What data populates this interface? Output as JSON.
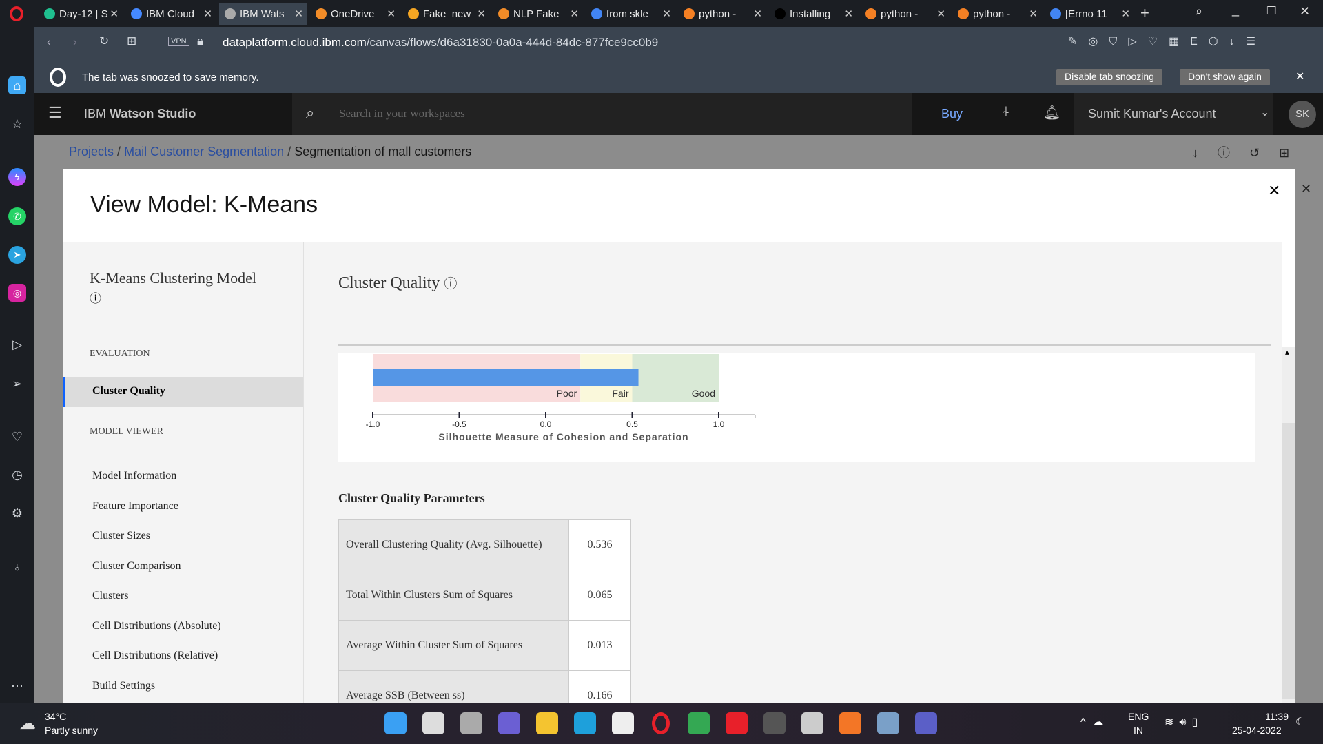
{
  "browser": {
    "tabs": [
      {
        "label": "Day-12 | S",
        "color": "#1fbf8f"
      },
      {
        "label": "IBM Cloud",
        "color": "#4589ff"
      },
      {
        "label": "IBM Wats",
        "color": "#aaaaaa",
        "active": true
      },
      {
        "label": "OneDrive",
        "color": "#f28c28"
      },
      {
        "label": "Fake_new",
        "color": "#f5a623"
      },
      {
        "label": "NLP Fake",
        "color": "#f28c28"
      },
      {
        "label": "from skle",
        "color": "#4285f4"
      },
      {
        "label": "python -",
        "color": "#f48024"
      },
      {
        "label": "Installing",
        "color": "#000000"
      },
      {
        "label": "python -",
        "color": "#f48024"
      },
      {
        "label": "python -",
        "color": "#f48024"
      },
      {
        "label": "[Errno 11",
        "color": "#4285f4"
      }
    ],
    "url_host": "dataplatform.cloud.ibm.com",
    "url_path": "/canvas/flows/d6a31830-0a0a-444d-84dc-877fce9cc0b9",
    "vpn": "VPN",
    "snooze_message": "The tab was snoozed to save memory.",
    "disable_snoozing": "Disable tab snoozing",
    "dont_show": "Don't show again"
  },
  "header": {
    "brand_prefix": "IBM",
    "brand": "Watson Studio",
    "search_placeholder": "Search in your workspaces",
    "buy": "Buy",
    "account": "Sumit Kumar's Account",
    "avatar": "SK"
  },
  "breadcrumb": [
    "Projects",
    "Mail Customer Segmentation",
    "Segmentation of mall customers"
  ],
  "modal": {
    "title": "View Model: K-Means",
    "model_name": "K-Means Clustering Model",
    "sections": {
      "evaluation": "EVALUATION",
      "model_viewer": "MODEL VIEWER"
    },
    "eval_items": [
      "Cluster Quality"
    ],
    "viewer_items": [
      "Model Information",
      "Feature Importance",
      "Cluster Sizes",
      "Cluster Comparison",
      "Clusters",
      "Cell Distributions (Absolute)",
      "Cell Distributions (Relative)",
      "Build Settings"
    ],
    "section_title": "Cluster Quality",
    "params_title": "Cluster Quality Parameters",
    "params": [
      {
        "label": "Overall Clustering Quality (Avg. Silhouette)",
        "value": "0.536"
      },
      {
        "label": "Total Within Clusters Sum of Squares",
        "value": "0.065"
      },
      {
        "label": "Average Within Cluster Sum of Squares",
        "value": "0.013"
      },
      {
        "label": "Average SSB (Between ss)",
        "value": "0.166"
      }
    ]
  },
  "chart_data": {
    "type": "bar",
    "orientation": "horizontal",
    "xlabel": "Silhouette Measure of Cohesion and Separation",
    "xlim": [
      -1.0,
      1.0
    ],
    "ticks": [
      "-1.0",
      "-0.5",
      "0.0",
      "0.5",
      "1.0"
    ],
    "tick_values": [
      -1,
      -0.5,
      0,
      0.5,
      1
    ],
    "bands": [
      {
        "label": "Poor",
        "from": -1.0,
        "to": 0.2,
        "color": "#f9dcdc"
      },
      {
        "label": "Fair",
        "from": 0.2,
        "to": 0.5,
        "color": "#faf8db"
      },
      {
        "label": "Good",
        "from": 0.5,
        "to": 1.0,
        "color": "#d9e9d6"
      }
    ],
    "values": [
      0.536
    ],
    "bar_color": "#5596e6"
  },
  "taskbar": {
    "temp": "34°C",
    "weather": "Partly sunny",
    "lang": "ENG",
    "region": "IN",
    "time": "11:39",
    "date": "25-04-2022"
  }
}
